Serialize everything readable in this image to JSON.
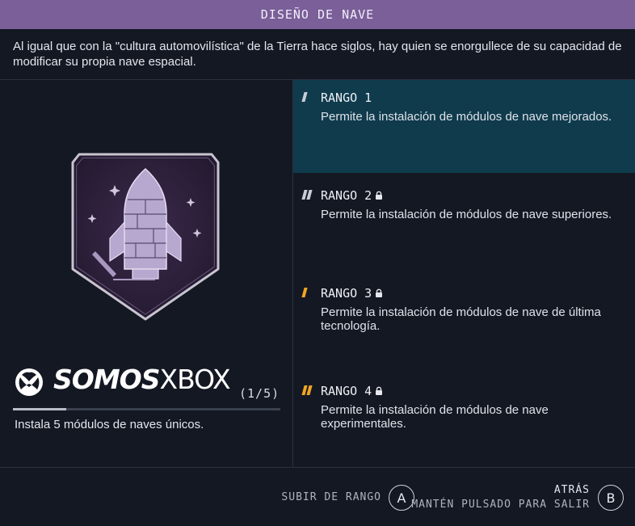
{
  "header": {
    "title": "DISEÑO DE NAVE"
  },
  "description": "Al igual que con la \"cultura automovilística\" de la Tierra hace siglos, hay quien se enorgullece de su capacidad de modificar su propia nave espacial.",
  "brand": {
    "logo_text_bold": "SOMOS",
    "logo_text_thin": "XBOX"
  },
  "progress": {
    "count_label": "(1/5)",
    "current": 1,
    "total": 5,
    "task": "Instala 5 módulos de naves únicos."
  },
  "ranks": [
    {
      "title": "RANGO 1",
      "description": "Permite la instalación de módulos de nave mejorados.",
      "locked": false,
      "selected": true,
      "pip_color": "#c9ccd6",
      "pips": 1
    },
    {
      "title": "RANGO 2",
      "description": "Permite la instalación de módulos de nave superiores.",
      "locked": true,
      "selected": false,
      "pip_color": "#c9ccd6",
      "pips": 2
    },
    {
      "title": "RANGO 3",
      "description": "Permite la instalación de módulos de nave de última tecnología.",
      "locked": true,
      "selected": false,
      "pip_color": "#f0a623",
      "pips": 1
    },
    {
      "title": "RANGO 4",
      "description": "Permite la instalación de módulos de nave experimentales.",
      "locked": true,
      "selected": false,
      "pip_color": "#f0a623",
      "pips": 2
    }
  ],
  "footer": {
    "rank_up_label": "SUBIR DE RANGO",
    "rank_up_key": "A",
    "back_label": "ATRÁS",
    "back_hint": "MANTÉN PULSADO PARA SALIR",
    "back_key": "B"
  },
  "colors": {
    "header_bg": "#7a5f98",
    "active_rank_bg": "#0f3b4d",
    "gold": "#f0a623"
  }
}
